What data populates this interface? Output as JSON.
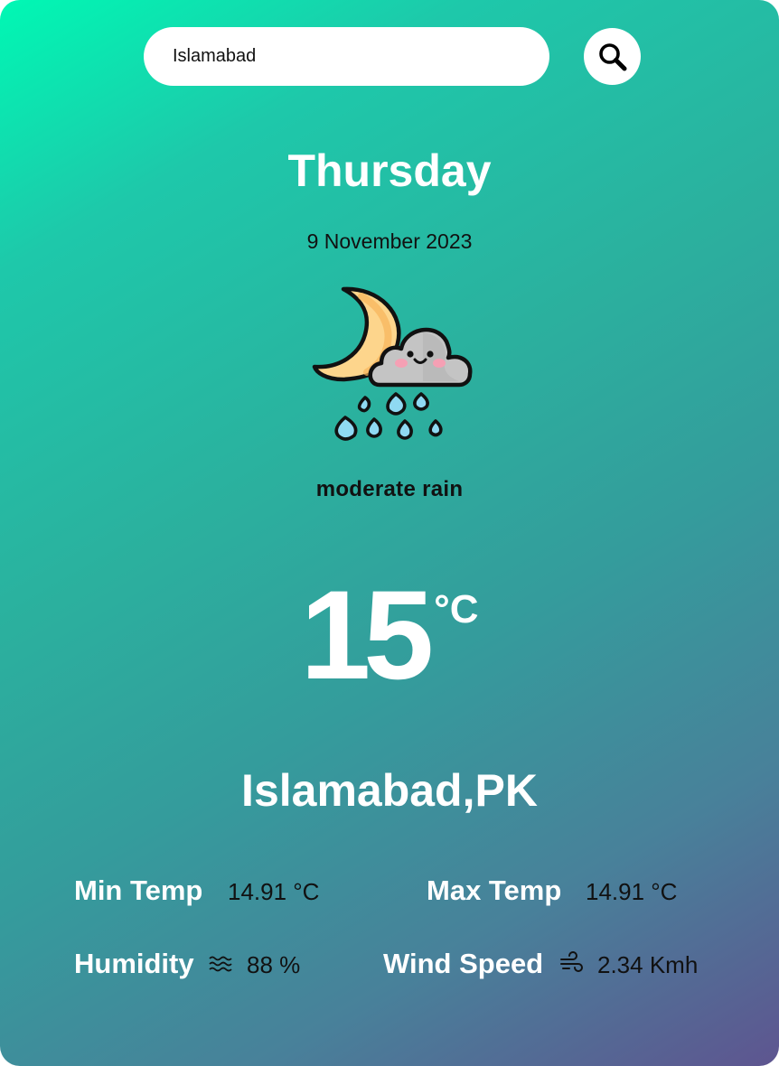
{
  "search": {
    "value": "Islamabad",
    "placeholder": "",
    "button_icon": "search-icon"
  },
  "forecast": {
    "day": "Thursday",
    "date": "9 November 2023",
    "icon": "moon-cloud-rain-icon",
    "description": "moderate rain",
    "temperature": "15",
    "temperature_unit": "°C",
    "city": "Islamabad,PK"
  },
  "stats": {
    "min_temp": {
      "label": "Min Temp",
      "value": "14.91 °C"
    },
    "max_temp": {
      "label": "Max Temp",
      "value": "14.91 °C"
    },
    "humidity": {
      "label": "Humidity",
      "value": "88 %",
      "icon": "humidity-waves-icon"
    },
    "wind_speed": {
      "label": "Wind Speed",
      "value": "2.34 Kmh",
      "icon": "wind-icon"
    }
  },
  "colors": {
    "gradient_start": "#00f8b4",
    "gradient_end": "#5e5590",
    "text_light": "#ffffff",
    "text_dark": "#111111"
  }
}
